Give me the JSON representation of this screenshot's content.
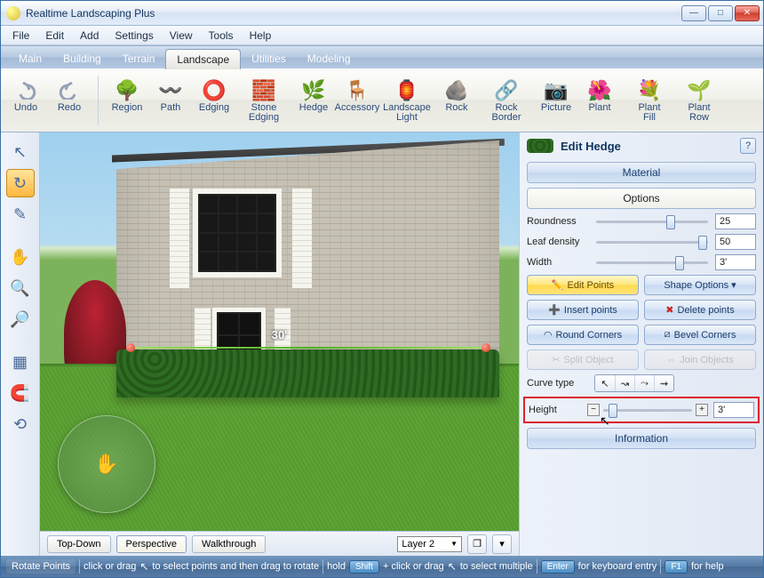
{
  "title": "Realtime Landscaping Plus",
  "menus": [
    "File",
    "Edit",
    "Add",
    "Settings",
    "View",
    "Tools",
    "Help"
  ],
  "tabs": [
    "Main",
    "Building",
    "Terrain",
    "Landscape",
    "Utilities",
    "Modeling"
  ],
  "active_tab": "Landscape",
  "ribbon": {
    "undo": "Undo",
    "redo": "Redo",
    "items": [
      {
        "label": "Region",
        "icon": "🌳"
      },
      {
        "label": "Path",
        "icon": "〰️"
      },
      {
        "label": "Edging",
        "icon": "⭕"
      },
      {
        "label": "Stone Edging",
        "icon": "🧱"
      },
      {
        "label": "Hedge",
        "icon": "🌿"
      },
      {
        "label": "Accessory",
        "icon": "🪑"
      },
      {
        "label": "Landscape Light",
        "icon": "🏮"
      },
      {
        "label": "Rock",
        "icon": "🪨"
      },
      {
        "label": "Rock Border",
        "icon": "🔗"
      },
      {
        "label": "Picture",
        "icon": "📷"
      },
      {
        "label": "Plant",
        "icon": "🌺"
      },
      {
        "label": "Plant Fill",
        "icon": "💐"
      },
      {
        "label": "Plant Row",
        "icon": "🌱"
      }
    ]
  },
  "viewport": {
    "measure_label": "30'",
    "modes": {
      "topdown": "Top-Down",
      "perspective": "Perspective",
      "walkthrough": "Walkthrough"
    },
    "active_mode": "Perspective",
    "layer": "Layer 2"
  },
  "panel": {
    "title": "Edit Hedge",
    "material": "Material",
    "options": "Options",
    "roundness": {
      "label": "Roundness",
      "value": "25",
      "thumb": 62
    },
    "leaf": {
      "label": "Leaf density",
      "value": "50",
      "thumb": 90
    },
    "width": {
      "label": "Width",
      "value": "3'",
      "thumb": 70
    },
    "edit_points": "Edit Points",
    "shape_options": "Shape Options  ▾",
    "insert": "Insert points",
    "delete": "Delete points",
    "roundc": "Round Corners",
    "bevelc": "Bevel Corners",
    "split": "Split Object",
    "join": "Join Objects",
    "curve_label": "Curve type",
    "height": {
      "label": "Height",
      "value": "3'"
    },
    "information": "Information"
  },
  "status": {
    "mode": "Rotate Points",
    "seg1a": "click or drag",
    "seg1b": "to select points and then drag to rotate",
    "hold": "hold",
    "shift": "Shift",
    "seg2": "+ click or drag",
    "seg2b": "to select multiple",
    "enter": "Enter",
    "seg3": "for keyboard entry",
    "f1": "F1",
    "seg4": "for help"
  }
}
